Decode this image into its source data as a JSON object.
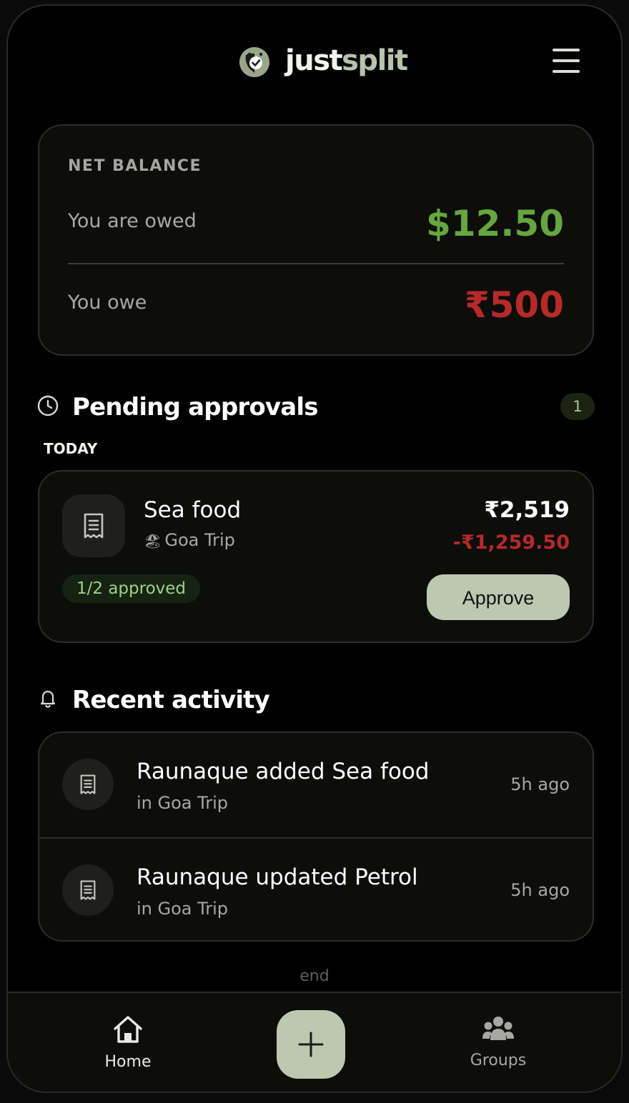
{
  "header": {
    "brand_part1": "just",
    "brand_part2": "split",
    "logo_icon": "check-face-icon",
    "menu_icon": "hamburger-menu-icon"
  },
  "balance": {
    "label": "NET BALANCE",
    "owed_label": "You are owed",
    "owed_amount": "$12.50",
    "owe_label": "You owe",
    "owe_amount": "₹500",
    "owed_color": "#65a63f",
    "owe_color": "#b62a2a"
  },
  "pending": {
    "title": "Pending approvals",
    "count": "1",
    "day_label": "TODAY",
    "items": [
      {
        "title": "Sea food",
        "group": "Goa Trip",
        "group_icon": "beach-umbrella-icon",
        "amount": "₹2,519",
        "share": "-₹1,259.50",
        "status": "1/2 approved",
        "action_label": "Approve"
      }
    ]
  },
  "recent": {
    "title": "Recent activity",
    "items": [
      {
        "title": "Raunaque added Sea food",
        "subtitle": "in Goa Trip",
        "time": "5h ago",
        "icon": "receipt-icon"
      },
      {
        "title": "Raunaque updated Petrol",
        "subtitle": "in Goa Trip",
        "time": "5h ago",
        "icon": "receipt-icon"
      }
    ],
    "end_label": "end"
  },
  "nav": {
    "home_label": "Home",
    "groups_label": "Groups",
    "add_icon": "plus-icon"
  },
  "colors": {
    "accent": "#bcc8b0",
    "positive": "#65a63f",
    "negative": "#b62a2a",
    "background": "#000000"
  }
}
